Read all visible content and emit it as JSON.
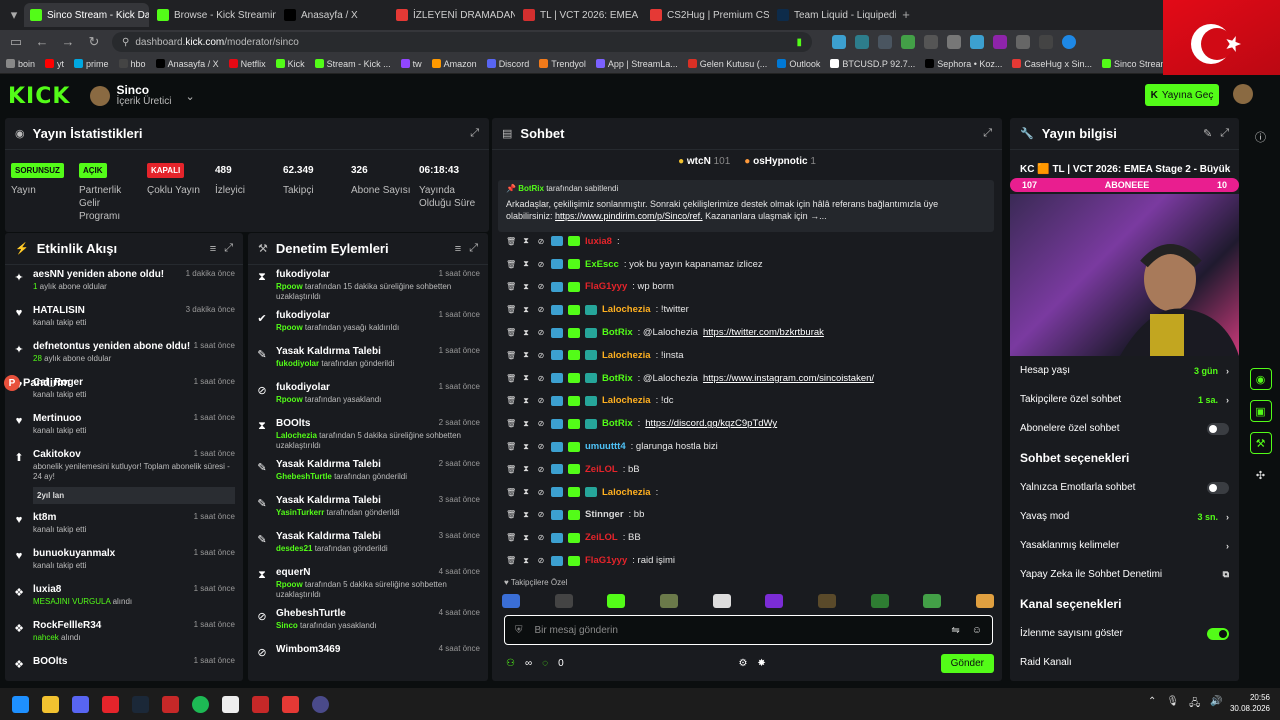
{
  "browser": {
    "tabs": [
      {
        "label": "Sinco Stream - Kick Dashbo",
        "active": true,
        "color": "#53fc18"
      },
      {
        "label": "Browse - Kick Streaming",
        "active": false,
        "color": "#53fc18"
      },
      {
        "label": "Anasayfa / X",
        "active": false,
        "color": "#000000"
      },
      {
        "label": "İZLEYENİ DRAMADAN UZA",
        "active": false,
        "color": "#e53935"
      },
      {
        "label": "TL | VCT 2026: EMEA",
        "active": false,
        "color": "#d32f2f"
      },
      {
        "label": "CS2Hug | Premium CS2 & C",
        "active": false,
        "color": "#e53935"
      },
      {
        "label": "Team Liquid - Liquipedia V",
        "active": false,
        "color": "#0d2b4a"
      }
    ],
    "url_prefix": "dashboard.",
    "url_domain": "kick.com",
    "url_path": "/moderator/sinco",
    "bookmarks": [
      {
        "label": "boin",
        "color": "#888888"
      },
      {
        "label": "yt",
        "color": "#ff0000"
      },
      {
        "label": "prime",
        "color": "#00a8e1"
      },
      {
        "label": "hbo",
        "color": "#444444"
      },
      {
        "label": "Anasayfa / X",
        "color": "#000000"
      },
      {
        "label": "Netflix",
        "color": "#e50914"
      },
      {
        "label": "Kick",
        "color": "#53fc18"
      },
      {
        "label": "Stream - Kick ...",
        "color": "#53fc18"
      },
      {
        "label": "tw",
        "color": "#9146ff"
      },
      {
        "label": "Amazon",
        "color": "#ff9900"
      },
      {
        "label": "Discord",
        "color": "#5865f2"
      },
      {
        "label": "Trendyol",
        "color": "#f27a1a"
      },
      {
        "label": "App | StreamLa...",
        "color": "#7b61ff"
      },
      {
        "label": "Gelen Kutusu (...",
        "color": "#d93025"
      },
      {
        "label": "Outlook",
        "color": "#0078d4"
      },
      {
        "label": "BTCUSD.P 92.7...",
        "color": "#ffffff"
      },
      {
        "label": "Sephora • Koz...",
        "color": "#000000"
      },
      {
        "label": "CaseHug x Sin...",
        "color": "#e53935"
      },
      {
        "label": "Sinco Stream - ...",
        "color": "#53fc18"
      }
    ]
  },
  "header": {
    "logo": "KICK",
    "channel_name": "Sinco",
    "channel_role": "İçerik Üretici",
    "go_live_label": "Yayına Geç"
  },
  "stats": {
    "title": "Yayın İstatistikleri",
    "items": [
      {
        "value": "SORUNSUZ",
        "label": "Yayın",
        "badge_color": "#53fc18",
        "badge_text": "#0b0e0f"
      },
      {
        "value": "AÇIK",
        "label": "Partnerlik Gelir Programı",
        "badge_color": "#53fc18",
        "badge_text": "#0b0e0f"
      },
      {
        "value": "KAPALI",
        "label": "Çoklu Yayın",
        "badge_color": "#e5242b",
        "badge_text": "#ffffff"
      },
      {
        "value": "489",
        "label": "İzleyici"
      },
      {
        "value": "62.349",
        "label": "Takipçi"
      },
      {
        "value": "326",
        "label": "Abone Sayısı"
      },
      {
        "value": "06:18:43",
        "label": "Yayında Olduğu Süre"
      }
    ]
  },
  "feed": {
    "title": "Etkinlik Akışı",
    "items": [
      {
        "icon": "✦",
        "user": "aesNN yeniden abone oldu!",
        "time": "1 dakika önce",
        "pre": "1",
        "sub": " aylık abone oldular"
      },
      {
        "icon": "♥",
        "user": "HATALISIN",
        "time": "3 dakika önce",
        "pre": "",
        "sub": "kanalı takip etti"
      },
      {
        "icon": "✦",
        "user": "defnetontus yeniden abone oldu!",
        "time": "1 saat önce",
        "pre": "28",
        "sub": " aylık abone oldular"
      },
      {
        "icon": "♥",
        "user": "Cal_Roger",
        "time": "1 saat önce",
        "pre": "",
        "sub": "kanalı takip etti"
      },
      {
        "icon": "♥",
        "user": "Mertinuoo",
        "time": "1 saat önce",
        "pre": "",
        "sub": "kanalı takip etti"
      },
      {
        "icon": "⬆",
        "user": "Cakitokov",
        "time": "1 saat önce",
        "pre": "",
        "sub": "abonelik yenilemesini kutluyor! Toplam abonelik süresi - 24 ay!",
        "tag": "2yıl lan"
      },
      {
        "icon": "♥",
        "user": "kt8m",
        "time": "1 saat önce",
        "pre": "",
        "sub": "kanalı takip etti"
      },
      {
        "icon": "♥",
        "user": "bunuokuyanmalx",
        "time": "1 saat önce",
        "pre": "",
        "sub": "kanalı takip etti"
      },
      {
        "icon": "❖",
        "user": "luxia8",
        "time": "1 saat önce",
        "pre": "MESAJINI VURGULA",
        "sub": " alındı"
      },
      {
        "icon": "❖",
        "user": "RockFellleR34",
        "time": "1 saat önce",
        "pre": "nahcek",
        "sub": " alındı"
      },
      {
        "icon": "❖",
        "user": "BOOlts",
        "time": "1 saat önce",
        "pre": "",
        "sub": ""
      }
    ]
  },
  "moderation": {
    "title": "Denetim Eylemleri",
    "items": [
      {
        "icon": "⧗",
        "user": "fukodiyolar",
        "time": "1 saat önce",
        "actor": "Rpoow",
        "sub": " tarafından 15 dakika süreliğine sohbetten uzaklaştırıldı"
      },
      {
        "icon": "✔",
        "user": "fukodiyolar",
        "time": "1 saat önce",
        "actor": "Rpoow",
        "sub": " tarafından yasağı kaldırıldı"
      },
      {
        "icon": "✎",
        "user": "Yasak Kaldırma Talebi",
        "time": "1 saat önce",
        "actor": "fukodiyolar",
        "sub": " tarafından gönderildi"
      },
      {
        "icon": "⊘",
        "user": "fukodiyolar",
        "time": "1 saat önce",
        "actor": "Rpoow",
        "sub": " tarafından yasaklandı"
      },
      {
        "icon": "⧗",
        "user": "BOOlts",
        "time": "2 saat önce",
        "actor": "Lalochezia",
        "sub": " tarafından 5 dakika süreliğine sohbetten uzaklaştırıldı"
      },
      {
        "icon": "✎",
        "user": "Yasak Kaldırma Talebi",
        "time": "2 saat önce",
        "actor": "GhebeshTurtle",
        "sub": " tarafından gönderildi"
      },
      {
        "icon": "✎",
        "user": "Yasak Kaldırma Talebi",
        "time": "3 saat önce",
        "actor": "YasinTurkerr",
        "sub": " tarafından gönderildi"
      },
      {
        "icon": "✎",
        "user": "Yasak Kaldırma Talebi",
        "time": "3 saat önce",
        "actor": "desdes21",
        "sub": " tarafından gönderildi"
      },
      {
        "icon": "⧗",
        "user": "equerN",
        "time": "4 saat önce",
        "actor": "Rpoow",
        "sub": " tarafından 5 dakika süreliğine sohbetten uzaklaştırıldı"
      },
      {
        "icon": "⊘",
        "user": "GhebeshTurtle",
        "time": "4 saat önce",
        "actor": "Sinco",
        "sub": " tarafından yasaklandı"
      },
      {
        "icon": "⊘",
        "user": "Wimbom3469",
        "time": "4 saat önce",
        "actor": "",
        "sub": ""
      }
    ]
  },
  "chat": {
    "title": "Sohbet",
    "top_users": [
      {
        "name": "wtcN",
        "count": "101"
      },
      {
        "name": "osHypnotic",
        "count": "1"
      }
    ],
    "pinned": {
      "by": "BotRix",
      "by_suffix": " tarafından sabitlendi",
      "text": "Arkadaşlar, çekilişimiz sonlanmıştır. Sonraki çekilişlerimize destek olmak için hâlâ referans bağlantımızla üye olabilirsiniz: ",
      "link": "https://www.pindirim.com/p/Sinco/ref.",
      "tail": " Kazananlara ulaşmak için →..."
    },
    "messages": [
      {
        "user": "luxia8",
        "color": "#e5242b",
        "text": ":",
        "link": ""
      },
      {
        "user": "ExEscc",
        "color": "#53fc18",
        "text": ": yok bu yayın kapanamaz izlicez",
        "link": ""
      },
      {
        "user": "FlaG1yyy",
        "color": "#e5242b",
        "text": ": wp borm",
        "link": ""
      },
      {
        "user": "Lalochezia",
        "color": "#ffb020",
        "text": ": !twitter",
        "link": ""
      },
      {
        "user": "BotRix",
        "color": "#53fc18",
        "text": ": @Lalochezia ",
        "link": "https://twitter.com/bzkrtburak"
      },
      {
        "user": "Lalochezia",
        "color": "#ffb020",
        "text": ": !insta",
        "link": ""
      },
      {
        "user": "BotRix",
        "color": "#53fc18",
        "text": ": @Lalochezia ",
        "link": "https://www.instagram.com/sincoistaken/"
      },
      {
        "user": "Lalochezia",
        "color": "#ffb020",
        "text": ": !dc",
        "link": ""
      },
      {
        "user": "BotRix",
        "color": "#53fc18",
        "text": ": ",
        "link": "https://discord.gg/kqzC9pTdWy"
      },
      {
        "user": "umuuttt4",
        "color": "#4fc3f7",
        "text": ": glarunga hostla bizi",
        "link": ""
      },
      {
        "user": "ZeiLOL",
        "color": "#e5242b",
        "text": ": bB",
        "link": ""
      },
      {
        "user": "Lalochezia",
        "color": "#ffb020",
        "text": ":",
        "link": ""
      },
      {
        "user": "Stinnger",
        "color": "#d7d7d7",
        "text": ": bb",
        "link": ""
      },
      {
        "user": "ZeiLOL",
        "color": "#e5242b",
        "text": ": BB",
        "link": ""
      },
      {
        "user": "FlaG1yyy",
        "color": "#e5242b",
        "text": ": raid işimi",
        "link": ""
      }
    ],
    "followers_only": "Takipçilere Özel",
    "input_placeholder": "Bir mesaj gönderin",
    "points": "0",
    "send_label": "Gönder"
  },
  "info": {
    "title": "Yayın bilgisi",
    "stream_title": "KC 🟧 TL | VCT 2026: EMEA Stage 2 - Büyük",
    "sub_goal_left": "107",
    "sub_goal_label": "ABONEEE",
    "sub_goal_right": "10",
    "rows1": [
      {
        "label": "Hesap yaşı",
        "value": "3 gün",
        "kind": "chevron"
      },
      {
        "label": "Takipçilere özel sohbet",
        "value": "1 sa.",
        "kind": "chevron"
      },
      {
        "label": "Abonelere özel sohbet",
        "value": "",
        "kind": "toggle-off"
      }
    ],
    "chat_section": "Sohbet seçenekleri",
    "rows2": [
      {
        "label": "Yalnızca Emotlarla sohbet",
        "value": "",
        "kind": "toggle-off"
      },
      {
        "label": "Yavaş mod",
        "value": "3 sn.",
        "kind": "chevron"
      },
      {
        "label": "Yasaklanmış kelimeler",
        "value": "",
        "kind": "chevron"
      },
      {
        "label": "Yapay Zeka ile Sohbet Denetimi",
        "value": "",
        "kind": "external"
      }
    ],
    "channel_section": "Kanal seçenekleri",
    "rows3": [
      {
        "label": "İzlenme sayısını göster",
        "value": "",
        "kind": "toggle-on"
      },
      {
        "label": "Raid Kanalı",
        "value": "",
        "kind": "none"
      }
    ]
  },
  "overlay": {
    "pandirim": "Pandirim"
  },
  "taskbar": {
    "time": "20:56",
    "date": "30.08.2026"
  }
}
